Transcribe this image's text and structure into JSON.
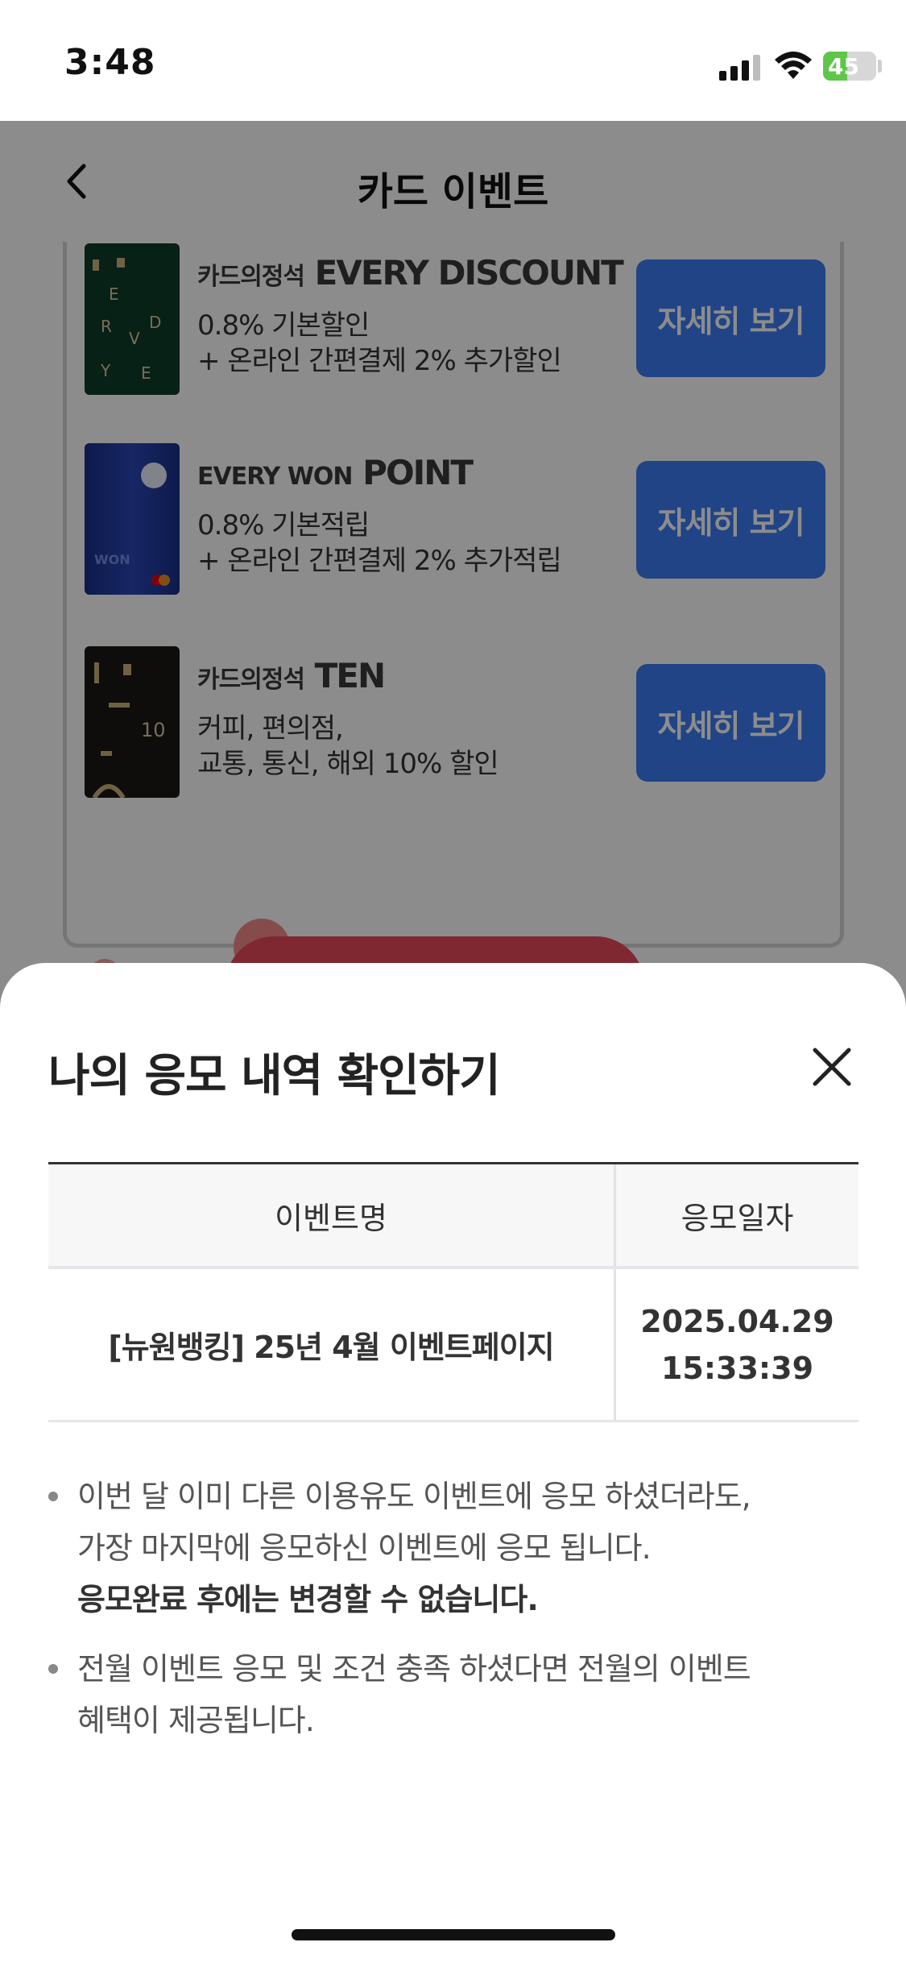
{
  "status_bar": {
    "time": "3:48",
    "battery": "45"
  },
  "header": {
    "title": "카드 이벤트"
  },
  "cards": [
    {
      "title_prefix": "카드의정석",
      "title_main": "EVERY DISCOUNT",
      "desc": "0.8% 기본할인\n+ 온라인 간편결제 2% 추가할인",
      "button": "자세히 보기",
      "color": "#0f3d2b"
    },
    {
      "title_prefix": "EVERY WON",
      "title_main": "POINT",
      "desc": "0.8% 기본적립\n+ 온라인 간편결제 2% 추가적립",
      "button": "자세히 보기",
      "color": "#1a2f8a"
    },
    {
      "title_prefix": "카드의정석",
      "title_main": "TEN",
      "desc": "커피, 편의점,\n교통, 통신, 해외 10% 할인",
      "button": "자세히 보기",
      "color": "#1a1816"
    }
  ],
  "sheet": {
    "title": "나의 응모 내역 확인하기",
    "table": {
      "headers": [
        "이벤트명",
        "응모일자"
      ],
      "rows": [
        {
          "event_name": "[뉴원뱅킹] 25년 4월 이벤트페이지",
          "date": "2025.04.29",
          "time": "15:33:39"
        }
      ]
    },
    "notes": [
      {
        "lines": [
          "이번 달 이미 다른 이용유도 이벤트에 응모 하셨더라도,",
          "가장 마지막에 응모하신 이벤트에 응모 됩니다."
        ],
        "strong": "응모완료 후에는 변경할 수 없습니다."
      },
      {
        "lines": [
          "전월 이벤트 응모 및 조건 충족 하셨다면 전월의 이벤트",
          "혜택이 제공됩니다."
        ],
        "strong": ""
      }
    ]
  },
  "colors": {
    "accent": "#3b7cf5",
    "dim": "rgba(0,0,0,0.45)"
  }
}
